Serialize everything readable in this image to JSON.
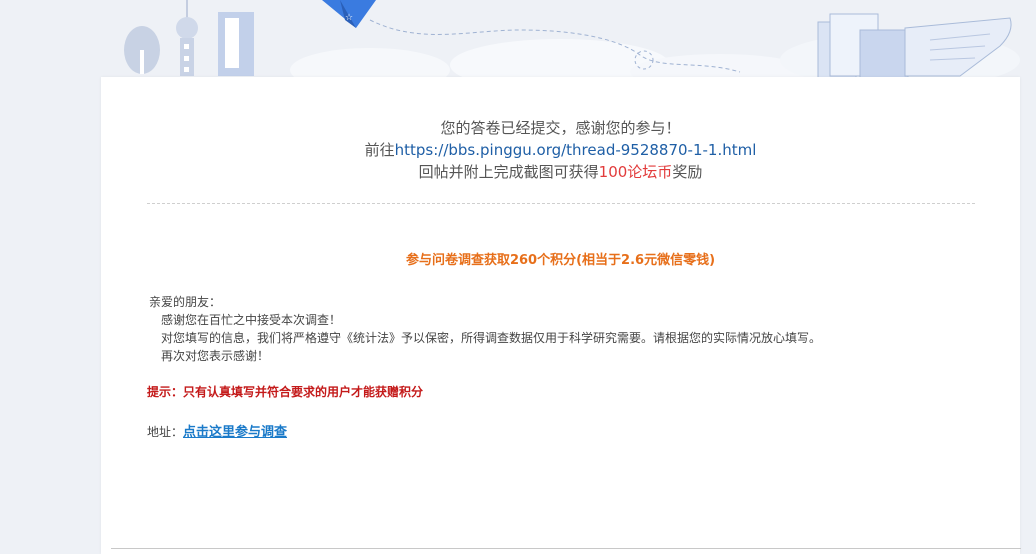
{
  "message": {
    "line1": "您的答卷已经提交，感谢您的参与！",
    "line2_prefix": "前往",
    "link": "https://bbs.pinggu.org/thread-9528870-1-1.html",
    "line3_prefix": "回帖并附上完成截图可获得",
    "reward": "100论坛币",
    "line3_suffix": "奖励"
  },
  "headline": "参与问卷调查获取260个积分(相当于2.6元微信零钱)",
  "body": {
    "greeting": "亲爱的朋友：",
    "p1": "感谢您在百忙之中接受本次调查！",
    "p2": "对您填写的信息，我们将严格遵守《统计法》予以保密，所得调查数据仅用于科学研究需要。请根据您的实际情况放心填写。",
    "p3": "再次对您表示感谢！"
  },
  "notice": "提示：只有认真填写并符合要求的用户才能获赠积分",
  "address": {
    "label": "地址：",
    "link_text": "点击这里参与调查"
  },
  "colors": {
    "headline": "#e76f1a",
    "reward": "#e23b3b",
    "notice": "#c41a1a",
    "link": "#1a7ac9"
  }
}
